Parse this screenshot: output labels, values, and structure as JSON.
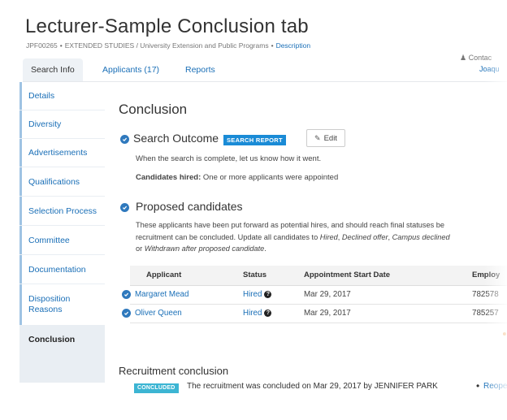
{
  "header": {
    "title": "Lecturer-Sample Conclusion tab",
    "job_id": "JPF00265",
    "unit": "EXTENDED STUDIES / University Extension and Public Programs",
    "description_link": "Description",
    "contact_label": "Contac",
    "contact_name": "Joaqu"
  },
  "tabs": [
    {
      "label": "Search Info"
    },
    {
      "label": "Applicants (17)"
    },
    {
      "label": "Reports"
    }
  ],
  "sidebar": {
    "items": [
      {
        "label": "Details"
      },
      {
        "label": "Diversity"
      },
      {
        "label": "Advertisements"
      },
      {
        "label": "Qualifications"
      },
      {
        "label": "Selection Process"
      },
      {
        "label": "Committee"
      },
      {
        "label": "Documentation"
      },
      {
        "label": "Disposition Reasons"
      },
      {
        "label": "Conclusion"
      }
    ]
  },
  "main": {
    "heading": "Conclusion",
    "search_outcome": {
      "title": "Search Outcome",
      "badge": "SEARCH REPORT",
      "edit_label": "Edit",
      "hint": "When the search is complete, let us know how it went.",
      "hired_label": "Candidates hired:",
      "hired_value": "One or more applicants were appointed"
    },
    "proposed": {
      "title": "Proposed candidates",
      "para_1": "These applicants have been put forward as potential hires, and should reach final statuses be",
      "para_2_prefix": "recruitment can be concluded. Update all candidates to ",
      "para_2_hired": "Hired",
      "para_2_sep": ", ",
      "para_2_declined": "Declined offer",
      "para_2_sep2": ", ",
      "para_2_campus": "Campus declined",
      "para_3_prefix": "or ",
      "para_3_withdrawn": "Withdrawn after proposed candidate",
      "para_3_suffix": "."
    },
    "table": {
      "headers": [
        "Applicant",
        "Status",
        "Appointment Start Date",
        "Employ"
      ],
      "rows": [
        {
          "applicant": "Margaret Mead",
          "status": "Hired",
          "start_date": "Mar 29, 2017",
          "employee_id": "782578"
        },
        {
          "applicant": "Oliver Queen",
          "status": "Hired",
          "start_date": "Mar 29, 2017",
          "employee_id": "785257"
        }
      ]
    },
    "recruitment": {
      "title": "Recruitment conclusion",
      "badge": "CONCLUDED",
      "text": "The recruitment was concluded on Mar 29, 2017 by JENNIFER PARK",
      "bullet": "•",
      "reopen_link": "Reope"
    }
  },
  "colors": {
    "link": "#1a6fb7",
    "accent_blue": "#1a8bd6",
    "check_blue": "#2f79bd",
    "concluded_badge": "#3cb5d3",
    "sidebar_bg": "#e9eef3"
  }
}
